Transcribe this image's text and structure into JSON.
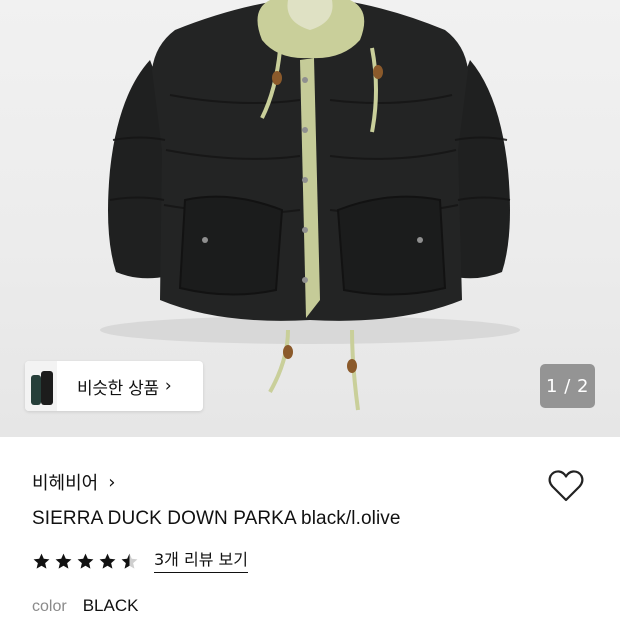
{
  "gallery": {
    "current_page": "1",
    "total_pages": "2",
    "separator": " / ",
    "similar_products_label": "비슷한 상품",
    "similar_chevron": "›"
  },
  "product": {
    "brand": "비헤비어",
    "brand_chevron": "›",
    "name": "SIERRA DUCK DOWN PARKA black/l.olive",
    "rating": 4.5,
    "review_link": "3개 리뷰 보기",
    "color_label": "color",
    "color_value": "BLACK"
  },
  "colors": {
    "jacket": "#1e1f1f",
    "lining": "#c9cf9a",
    "background": "#ececec",
    "indicator": "#7b7b7b"
  }
}
